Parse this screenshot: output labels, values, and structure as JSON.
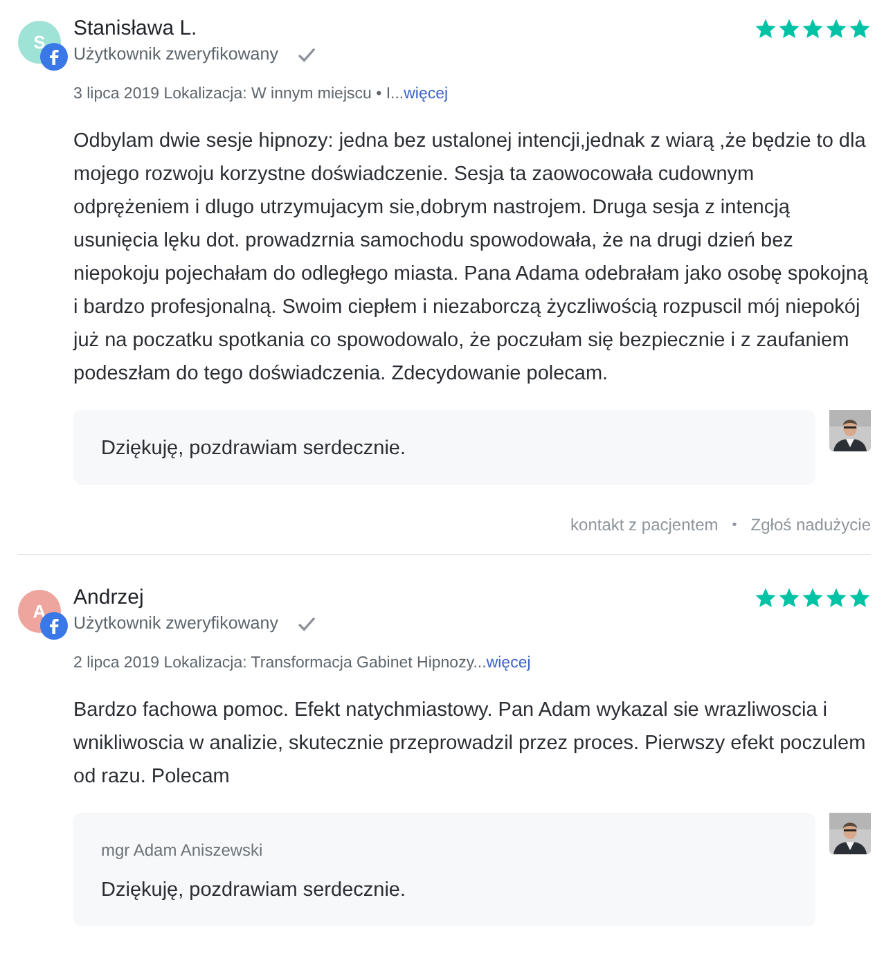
{
  "reviews": [
    {
      "initial": "S",
      "color": "#9fe3d6",
      "name": "Stanisława L.",
      "verified": "Użytkownik zweryfikowany",
      "stars": 5,
      "meta": "3 lipca 2019 Lokalizacja: W innym miejscu • I...",
      "more": "więcej",
      "text": "Odbylam dwie sesje hipnozy: jedna bez ustalonej intencji,jednak z wiarą ,że będzie to dla mojego rozwoju korzystne doświadczenie. Sesja ta zaowocowała cudownym odprężeniem i dlugo utrzymujacym sie,dobrym nastrojem. Druga sesja z intencją usunięcia lęku dot. prowadzrnia samochodu spowodowała, że na drugi dzień bez niepokoju pojechałam do odległego miasta. Pana Adama odebrałam jako osobę spokojną i bardzo profesjonalną. Swoim ciepłem i niezaborczą życzliwością rozpuscil mój niepokój już na poczatku spotkania co spowodowalo, że poczułam się bezpiecznie i z zaufaniem podeszłam do tego doświadczenia. Zdecydowanie polecam.",
      "reply": {
        "text": "Dziękuję, pozdrawiam serdecznie."
      },
      "actions": [
        "kontakt z pacjentem",
        "Zgłoś nadużycie"
      ],
      "actions_separator": "•"
    },
    {
      "initial": "A",
      "color": "#eea59d",
      "name": "Andrzej",
      "verified": "Użytkownik zweryfikowany",
      "stars": 5,
      "meta": "2 lipca 2019 Lokalizacja: Transformacja Gabinet Hipnozy...",
      "more": "więcej",
      "text": "Bardzo fachowa pomoc. Efekt natychmiastowy. Pan Adam wykazal sie wrazliwoscia i wnikliwoscia w analizie, skutecznie przeprowadzil przez proces. Pierwszy efekt poczulem od razu. Polecam",
      "reply": {
        "author": "mgr Adam Aniszewski",
        "text": "Dziękuję, pozdrawiam serdecznie."
      }
    }
  ]
}
